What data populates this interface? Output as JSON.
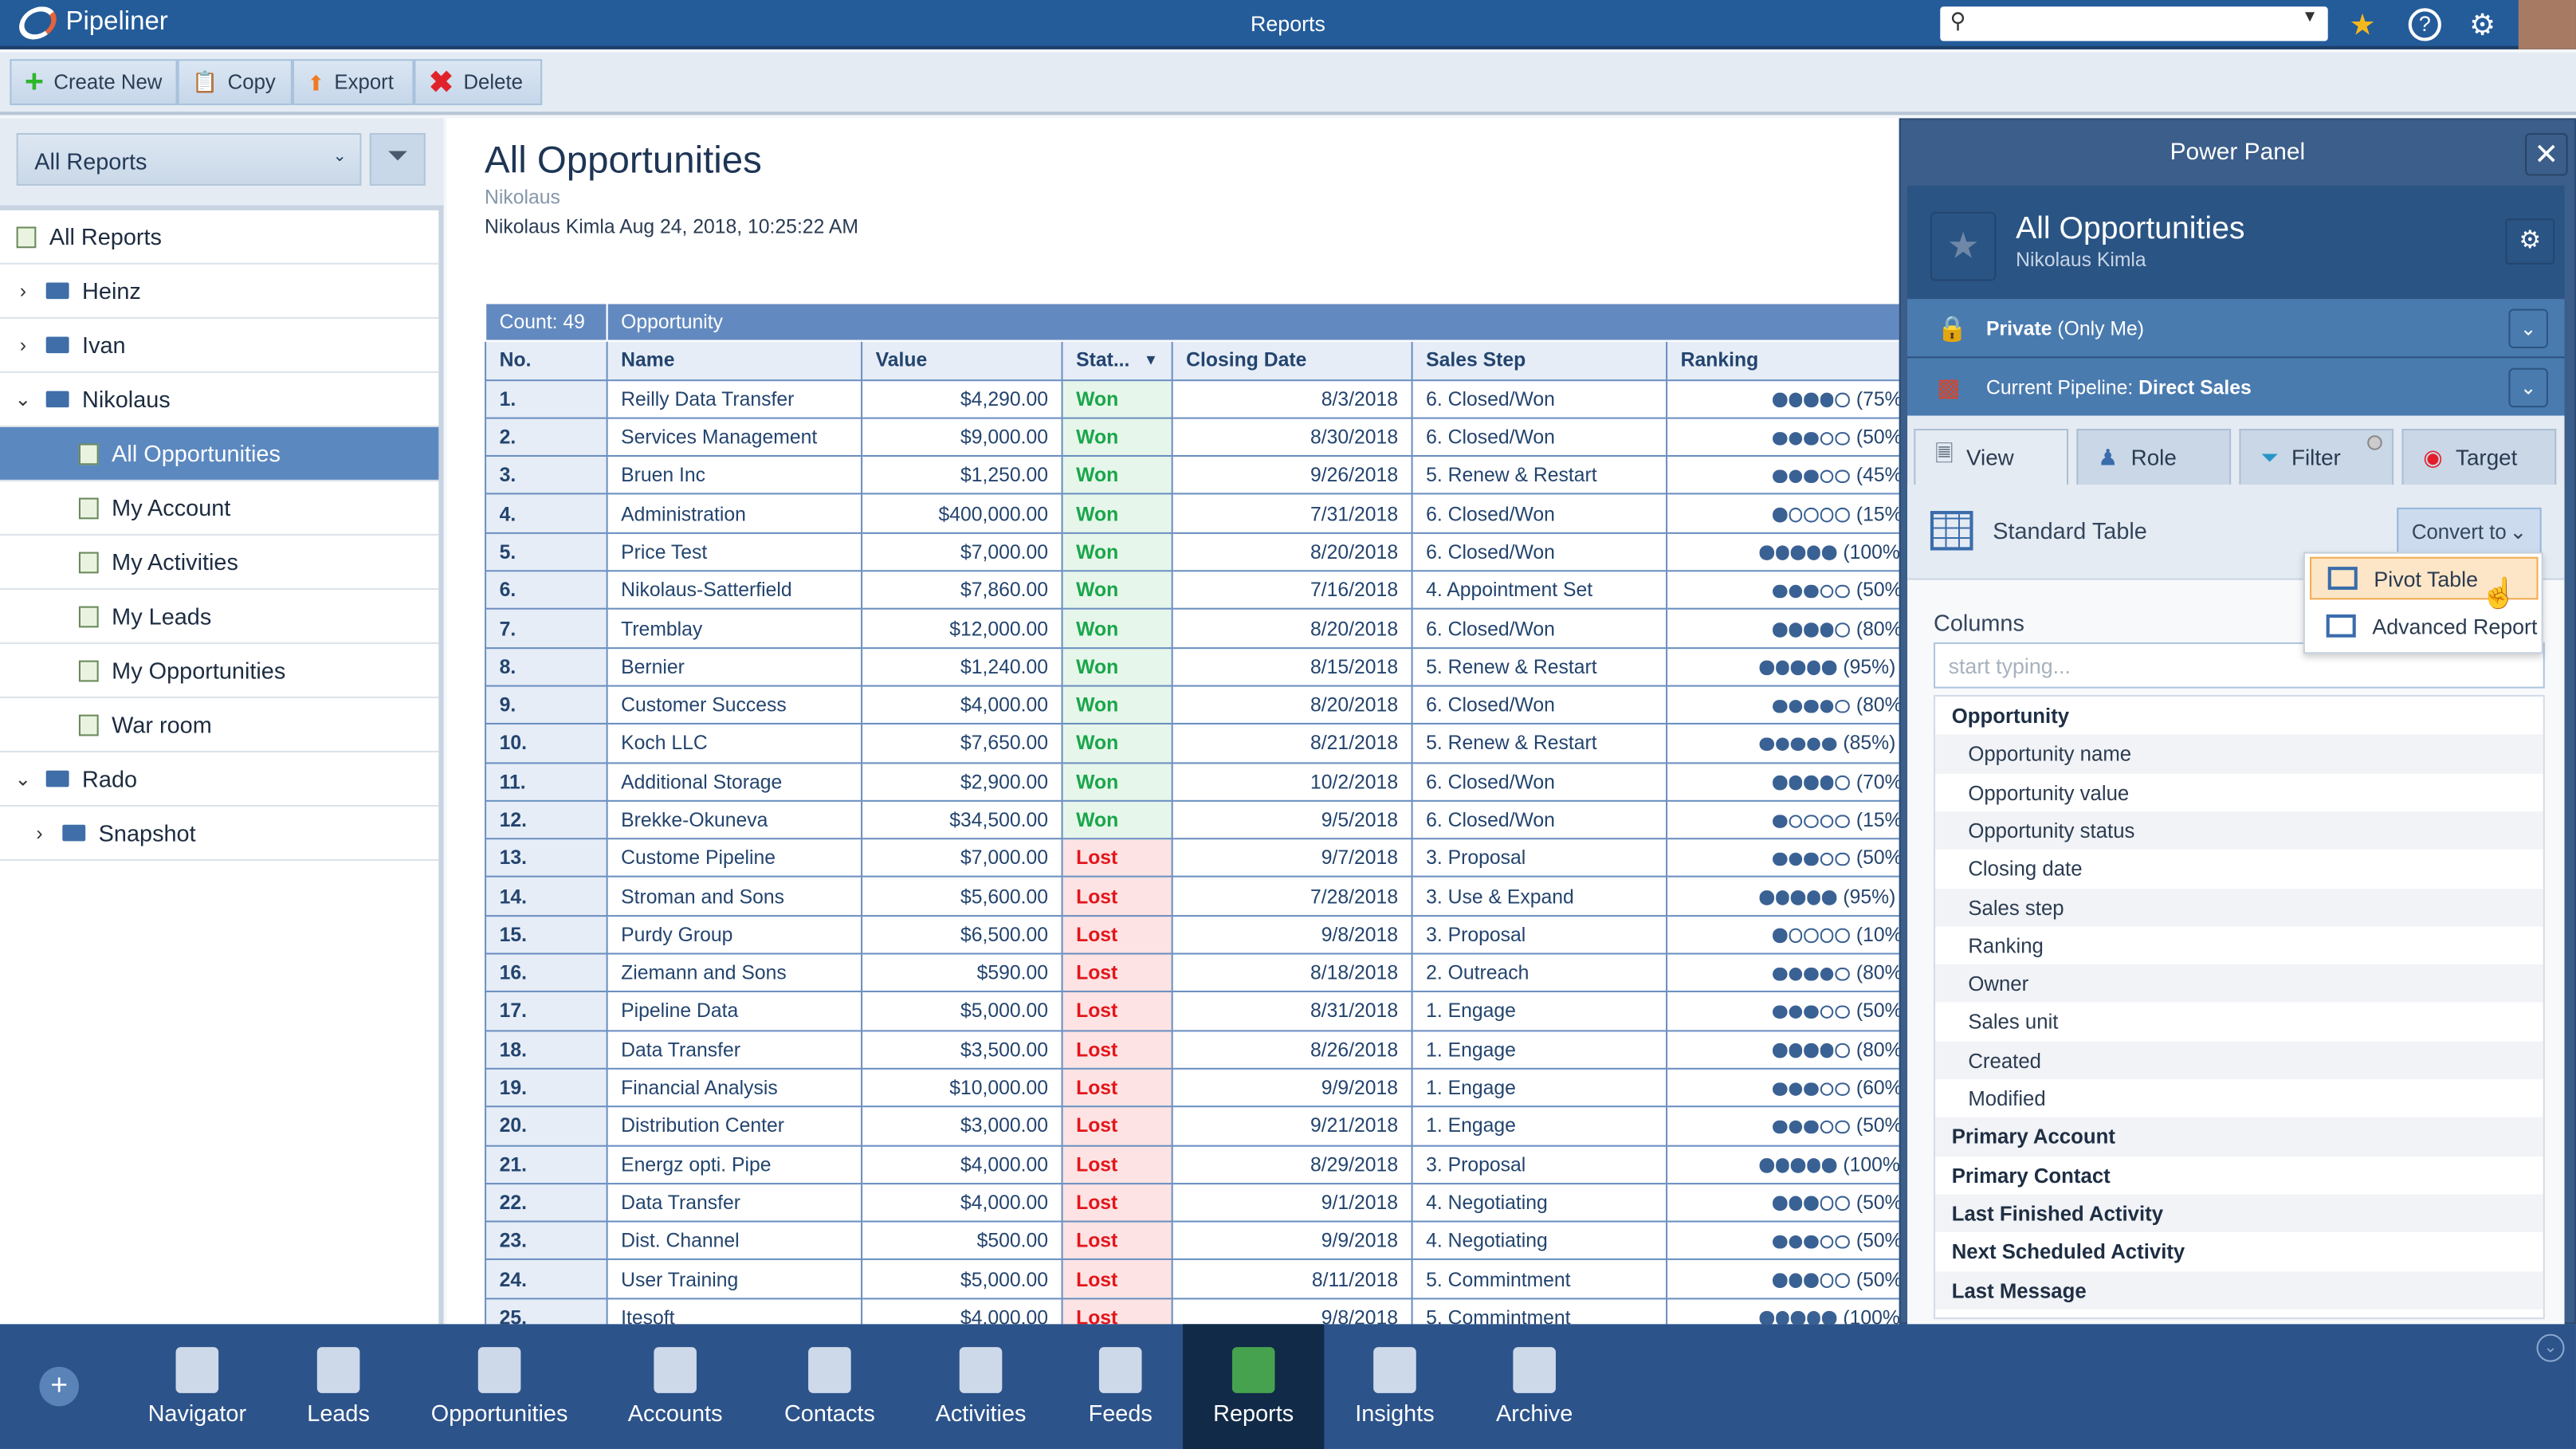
{
  "app": {
    "name": "Pipeliner",
    "title": "Reports",
    "search_placeholder": ""
  },
  "toolbar": {
    "create": "Create New",
    "copy": "Copy",
    "export": "Export",
    "delete": "Delete"
  },
  "sidebar": {
    "selector": "All Reports",
    "items": [
      {
        "label": "All Reports",
        "level": 0,
        "type": "report",
        "chevron": ""
      },
      {
        "label": "Heinz",
        "level": 0,
        "type": "folder",
        "chevron": "right"
      },
      {
        "label": "Ivan",
        "level": 0,
        "type": "folder",
        "chevron": "right"
      },
      {
        "label": "Nikolaus",
        "level": 0,
        "type": "folder",
        "chevron": "down"
      },
      {
        "label": "All Opportunities",
        "level": 1,
        "type": "report",
        "chevron": "",
        "selected": true
      },
      {
        "label": "My Account",
        "level": 1,
        "type": "report",
        "chevron": ""
      },
      {
        "label": "My Activities",
        "level": 1,
        "type": "report",
        "chevron": ""
      },
      {
        "label": "My Leads",
        "level": 1,
        "type": "report",
        "chevron": ""
      },
      {
        "label": "My Opportunities",
        "level": 1,
        "type": "report",
        "chevron": ""
      },
      {
        "label": "War room",
        "level": 1,
        "type": "report",
        "chevron": ""
      },
      {
        "label": "Rado",
        "level": 0,
        "type": "folder",
        "chevron": "down"
      },
      {
        "label": "Snapshot",
        "level": 1,
        "type": "folder",
        "chevron": "right"
      }
    ]
  },
  "report": {
    "title": "All Opportunities",
    "owner": "Nikolaus",
    "modified": "Nikolaus Kimla Aug 24, 2018, 10:25:22 AM",
    "count": "Count: 49",
    "group": "Opportunity",
    "columns": [
      "No.",
      "Name",
      "Value",
      "Stat...",
      "Closing Date",
      "Sales Step",
      "Ranking"
    ],
    "rows": [
      [
        "1.",
        "Reilly Data Transfer",
        "$4,290.00",
        "Won",
        "8/3/2018",
        "6. Closed/Won",
        4,
        "(75%)"
      ],
      [
        "2.",
        "Services Management",
        "$9,000.00",
        "Won",
        "8/30/2018",
        "6. Closed/Won",
        3,
        "(50%)"
      ],
      [
        "3.",
        "Bruen Inc",
        "$1,250.00",
        "Won",
        "9/26/2018",
        "5. Renew & Restart",
        3,
        "(45%)"
      ],
      [
        "4.",
        "Administration",
        "$400,000.00",
        "Won",
        "7/31/2018",
        "6. Closed/Won",
        1,
        "(15%)"
      ],
      [
        "5.",
        "Price Test",
        "$7,000.00",
        "Won",
        "8/20/2018",
        "6. Closed/Won",
        5,
        "(100%)"
      ],
      [
        "6.",
        "Nikolaus-Satterfield",
        "$7,860.00",
        "Won",
        "7/16/2018",
        "4. Appointment Set",
        3,
        "(50%)"
      ],
      [
        "7.",
        "Tremblay",
        "$12,000.00",
        "Won",
        "8/20/2018",
        "6. Closed/Won",
        4,
        "(80%)"
      ],
      [
        "8.",
        "Bernier",
        "$1,240.00",
        "Won",
        "8/15/2018",
        "5. Renew & Restart",
        5,
        "(95%)"
      ],
      [
        "9.",
        "Customer Success",
        "$4,000.00",
        "Won",
        "8/20/2018",
        "6. Closed/Won",
        4,
        "(80%)"
      ],
      [
        "10.",
        "Koch LLC",
        "$7,650.00",
        "Won",
        "8/21/2018",
        "5. Renew & Restart",
        5,
        "(85%)"
      ],
      [
        "11.",
        "Additional Storage",
        "$2,900.00",
        "Won",
        "10/2/2018",
        "6. Closed/Won",
        4,
        "(70%)"
      ],
      [
        "12.",
        "Brekke-Okuneva",
        "$34,500.00",
        "Won",
        "9/5/2018",
        "6. Closed/Won",
        1,
        "(15%)"
      ],
      [
        "13.",
        "Custome Pipeline",
        "$7,000.00",
        "Lost",
        "9/7/2018",
        "3. Proposal",
        3,
        "(50%)"
      ],
      [
        "14.",
        "Stroman and Sons",
        "$5,600.00",
        "Lost",
        "7/28/2018",
        "3. Use & Expand",
        5,
        "(95%)"
      ],
      [
        "15.",
        "Purdy Group",
        "$6,500.00",
        "Lost",
        "9/8/2018",
        "3. Proposal",
        1,
        "(10%)"
      ],
      [
        "16.",
        "Ziemann and Sons",
        "$590.00",
        "Lost",
        "8/18/2018",
        "2. Outreach",
        4,
        "(80%)"
      ],
      [
        "17.",
        "Pipeline Data",
        "$5,000.00",
        "Lost",
        "8/31/2018",
        "1. Engage",
        3,
        "(50%)"
      ],
      [
        "18.",
        "Data Transfer",
        "$3,500.00",
        "Lost",
        "8/26/2018",
        "1. Engage",
        4,
        "(80%)"
      ],
      [
        "19.",
        "Financial Analysis",
        "$10,000.00",
        "Lost",
        "9/9/2018",
        "1. Engage",
        3,
        "(60%)"
      ],
      [
        "20.",
        "Distribution Center",
        "$3,000.00",
        "Lost",
        "9/21/2018",
        "1. Engage",
        3,
        "(50%)"
      ],
      [
        "21.",
        "Energz opti. Pipe",
        "$4,000.00",
        "Lost",
        "8/29/2018",
        "3. Proposal",
        5,
        "(100%)"
      ],
      [
        "22.",
        "Data Transfer",
        "$4,000.00",
        "Lost",
        "9/1/2018",
        "4. Negotiating",
        3,
        "(50%)"
      ],
      [
        "23.",
        "Dist. Channel",
        "$500.00",
        "Lost",
        "9/9/2018",
        "4. Negotiating",
        3,
        "(50%)"
      ],
      [
        "24.",
        "User Training",
        "$5,000.00",
        "Lost",
        "8/11/2018",
        "5. Commintment",
        3,
        "(50%)"
      ],
      [
        "25.",
        "Itesoft",
        "$4,000.00",
        "Lost",
        "9/8/2018",
        "5. Commintment",
        5,
        "(100%)"
      ]
    ]
  },
  "power_panel": {
    "title": "Power Panel",
    "report_title": "All Opportunities",
    "report_owner": "Nikolaus Kimla",
    "privacy_bold": "Private",
    "privacy_rest": " (Only Me)",
    "pipeline_label": "Current Pipeline: ",
    "pipeline_value": "Direct Sales",
    "tabs": [
      "View",
      "Role",
      "Filter",
      "Target"
    ],
    "view_type": "Standard Table",
    "convert": "Convert to",
    "convert_options": [
      "Pivot Table",
      "Advanced Report"
    ],
    "columns_label": "Columns",
    "columns_placeholder": "start typing...",
    "columns": [
      {
        "label": "Opportunity",
        "group": true
      },
      {
        "label": "Opportunity name"
      },
      {
        "label": "Opportunity value"
      },
      {
        "label": "Opportunity status"
      },
      {
        "label": "Closing date"
      },
      {
        "label": "Sales step"
      },
      {
        "label": "Ranking"
      },
      {
        "label": "Owner"
      },
      {
        "label": "Sales unit"
      },
      {
        "label": "Created"
      },
      {
        "label": "Modified"
      },
      {
        "label": "Primary Account",
        "group": true
      },
      {
        "label": "Primary Contact",
        "group": true
      },
      {
        "label": "Last Finished Activity",
        "group": true
      },
      {
        "label": "Next Scheduled Activity",
        "group": true
      },
      {
        "label": "Last Message",
        "group": true
      }
    ]
  },
  "bottom_nav": {
    "items": [
      "Navigator",
      "Leads",
      "Opportunities",
      "Accounts",
      "Contacts",
      "Activities",
      "Feeds",
      "Reports",
      "Insights",
      "Archive"
    ],
    "active": "Reports"
  },
  "colors": {
    "brand": "#245c9a",
    "won": "#19a64a",
    "lost": "#e3161c",
    "highlight": "#fde6c7"
  }
}
